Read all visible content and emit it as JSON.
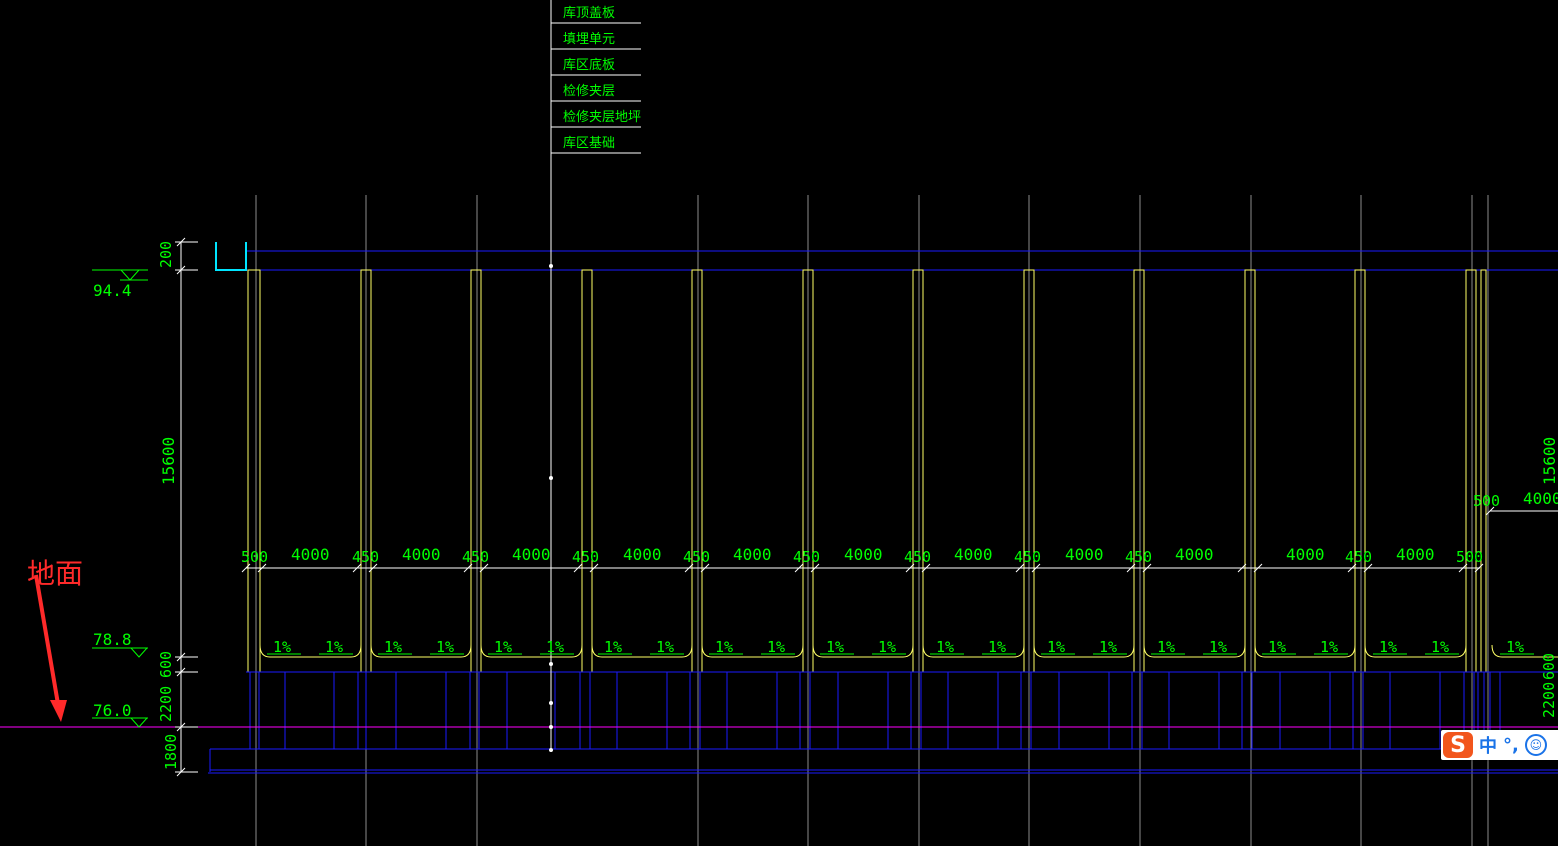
{
  "legend": {
    "items": [
      "库顶盖板",
      "填埋单元",
      "库区底板",
      "检修夹层",
      "检修夹层地坪",
      "库区基础"
    ]
  },
  "elevations": {
    "top": "94.4",
    "mid": "78.8",
    "ground": "76.0"
  },
  "left_dimensions": {
    "top": "200",
    "height": "15600",
    "slab": "600",
    "mezzanine": "2200",
    "base": "1800"
  },
  "right_dimensions": {
    "height": "15600",
    "width": "4000",
    "edge": "500",
    "mezzanine": "2200",
    "slab": "600"
  },
  "bay_dimensions": {
    "first_wall": "500",
    "bay": "4000",
    "wall": "450",
    "last_wall": "500"
  },
  "slope_label": "1%",
  "annotation": {
    "label": "地面",
    "color": "#ff2a2a"
  },
  "colors": {
    "background": "#000000",
    "wall": "#ffff66",
    "blue": "#1a1aff",
    "cyan": "#00e5ff",
    "dimension": "#00ff00",
    "grid": "#8c8c8c",
    "ground_line": "#ff00ff"
  },
  "ime": {
    "logo": "S",
    "lang": "中",
    "punct": "°,",
    "icon": "smile-icon"
  }
}
